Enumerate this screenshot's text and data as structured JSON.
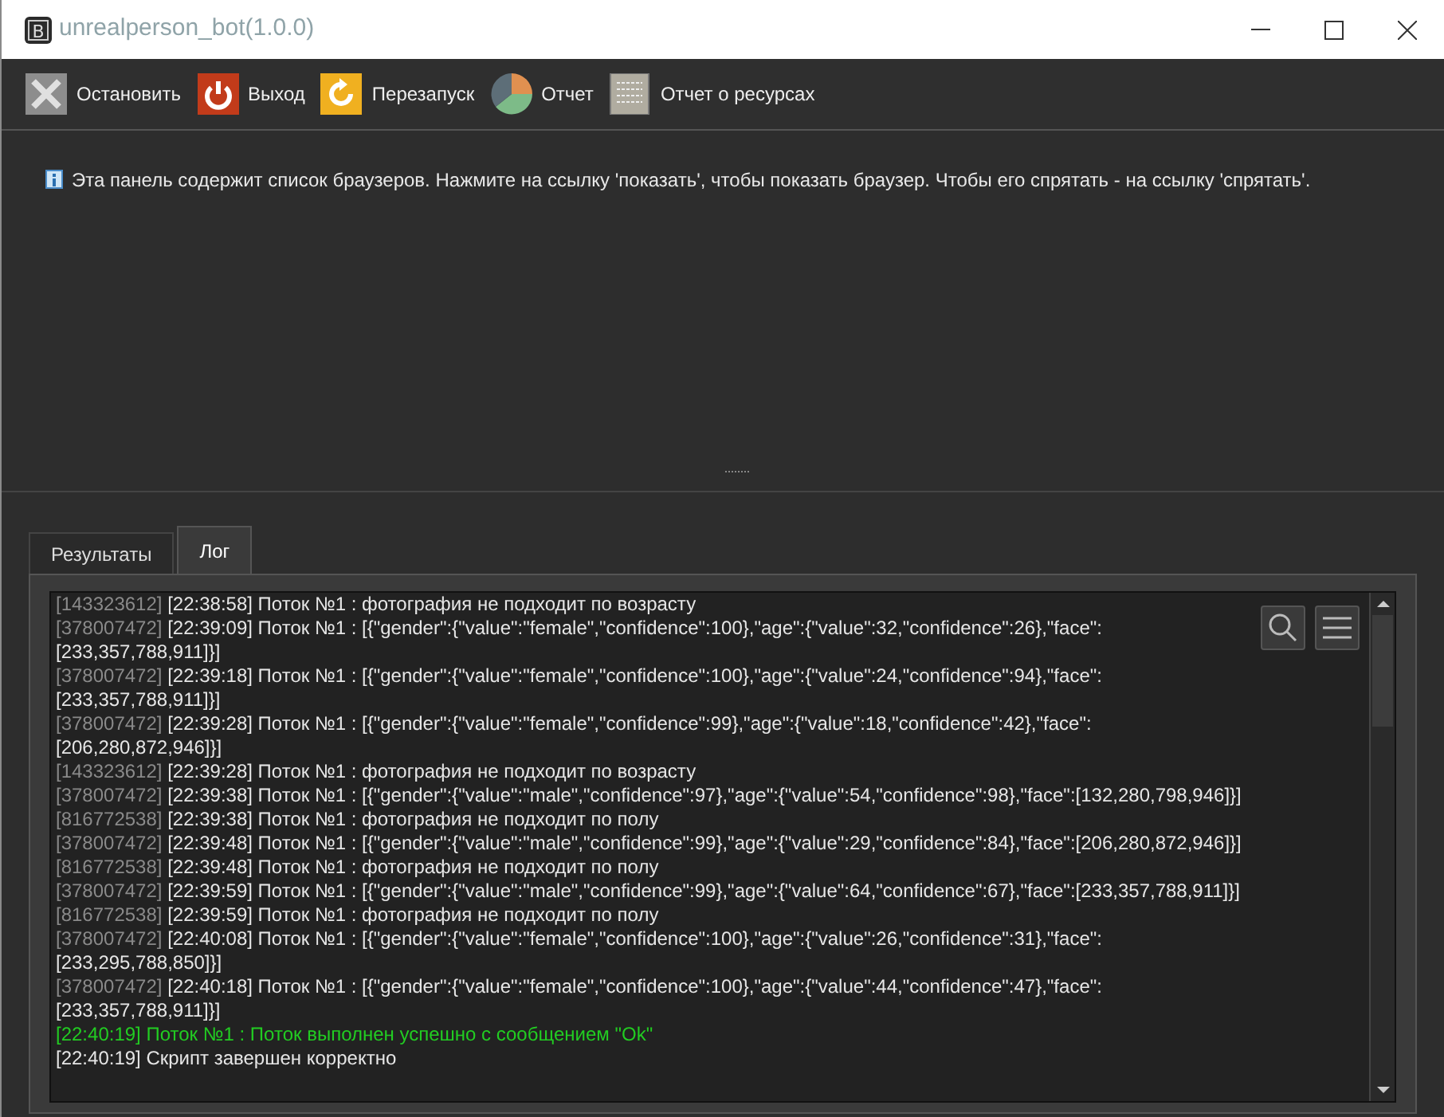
{
  "window": {
    "icon": "B",
    "title": "unrealperson_bot(1.0.0)"
  },
  "toolbar": [
    {
      "label": "Остановить",
      "kind": "stop"
    },
    {
      "label": "Выход",
      "kind": "exit"
    },
    {
      "label": "Перезапуск",
      "kind": "restart"
    },
    {
      "label": "Отчет",
      "kind": "report"
    },
    {
      "label": "Отчет о ресурсах",
      "kind": "resources"
    }
  ],
  "info": "Эта панель содержит список браузеров. Нажмите на ссылку 'показать', чтобы показать браузер. Чтобы его спрятать - на ссылку 'спрятать'.",
  "tabs": [
    {
      "label": "Результаты",
      "selected": false
    },
    {
      "label": "Лог",
      "selected": true
    }
  ],
  "log": [
    {
      "source": "[143323612]",
      "text": "[22:38:58] Поток №1 : фотография не подходит по возрасту",
      "kind": "info"
    },
    {
      "source": "[378007472]",
      "text": "[22:39:09] Поток №1 : [{\"gender\":{\"value\":\"female\",\"confidence\":100},\"age\":{\"value\":32,\"confidence\":26},\"face\": [233,357,788,911]}]",
      "kind": "info"
    },
    {
      "source": "[378007472]",
      "text": "[22:39:18] Поток №1 : [{\"gender\":{\"value\":\"female\",\"confidence\":100},\"age\":{\"value\":24,\"confidence\":94},\"face\": [233,357,788,911]}]",
      "kind": "info"
    },
    {
      "source": "[378007472]",
      "text": "[22:39:28] Поток №1 : [{\"gender\":{\"value\":\"female\",\"confidence\":99},\"age\":{\"value\":18,\"confidence\":42},\"face\": [206,280,872,946]}]",
      "kind": "info"
    },
    {
      "source": "[143323612]",
      "text": "[22:39:28] Поток №1 : фотография не подходит по возрасту",
      "kind": "info"
    },
    {
      "source": "[378007472]",
      "text": "[22:39:38] Поток №1 : [{\"gender\":{\"value\":\"male\",\"confidence\":97},\"age\":{\"value\":54,\"confidence\":98},\"face\":[132,280,798,946]}]",
      "kind": "info"
    },
    {
      "source": "[816772538]",
      "text": "[22:39:38] Поток №1 : фотография не подходит по полу",
      "kind": "info"
    },
    {
      "source": "[378007472]",
      "text": "[22:39:48] Поток №1 : [{\"gender\":{\"value\":\"male\",\"confidence\":99},\"age\":{\"value\":29,\"confidence\":84},\"face\":[206,280,872,946]}]",
      "kind": "info"
    },
    {
      "source": "[816772538]",
      "text": "[22:39:48] Поток №1 : фотография не подходит по полу",
      "kind": "info"
    },
    {
      "source": "[378007472]",
      "text": "[22:39:59] Поток №1 : [{\"gender\":{\"value\":\"male\",\"confidence\":99},\"age\":{\"value\":64,\"confidence\":67},\"face\":[233,357,788,911]}]",
      "kind": "info"
    },
    {
      "source": "[816772538]",
      "text": "[22:39:59] Поток №1 : фотография не подходит по полу",
      "kind": "info"
    },
    {
      "source": "[378007472]",
      "text": "[22:40:08] Поток №1 : [{\"gender\":{\"value\":\"female\",\"confidence\":100},\"age\":{\"value\":26,\"confidence\":31},\"face\": [233,295,788,850]}]",
      "kind": "info"
    },
    {
      "source": "[378007472]",
      "text": "[22:40:18] Поток №1 : [{\"gender\":{\"value\":\"female\",\"confidence\":100},\"age\":{\"value\":44,\"confidence\":47},\"face\": [233,357,788,911]}]",
      "kind": "info"
    },
    {
      "text": "[22:40:19] Поток №1 : Поток выполнен успешно с сообщением \"Ok\"",
      "kind": "success"
    },
    {
      "text": "[22:40:19] Скрипт завершен корректно",
      "kind": "plain"
    }
  ]
}
